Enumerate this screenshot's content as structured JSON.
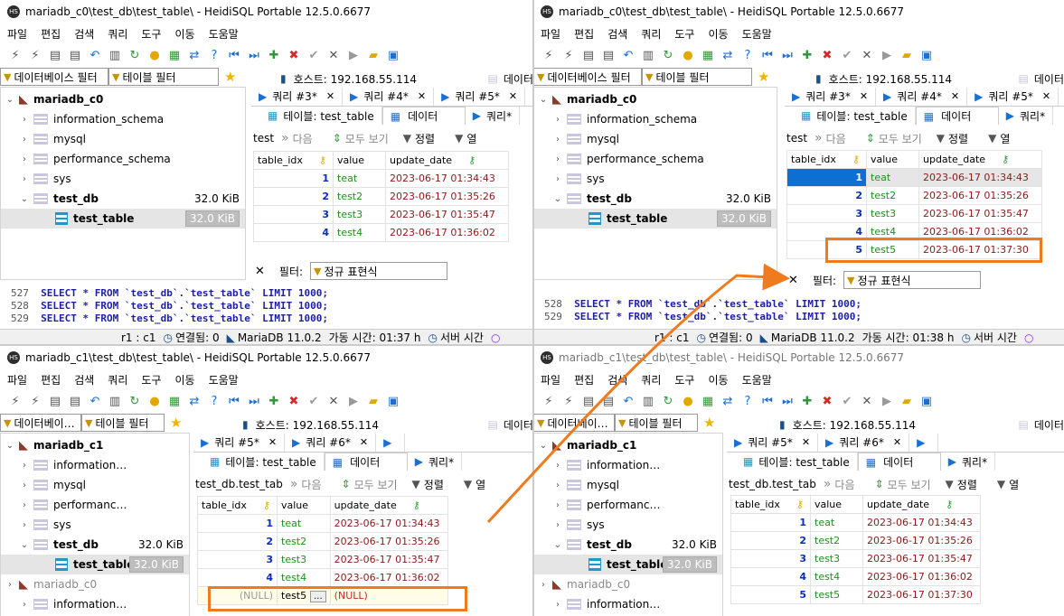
{
  "menu": [
    "파일",
    "편집",
    "검색",
    "쿼리",
    "도구",
    "이동",
    "도움말"
  ],
  "filters": {
    "db": "데이터베이스 필터",
    "db_short": "데이터베이…",
    "table": "테이블 필터"
  },
  "host_label": "호스트: 192.168.55.114",
  "data_tab_short": "데이터",
  "tabs": {
    "table": "테이블: test_table",
    "data": "데이터",
    "query": "쿼리*"
  },
  "nav": {
    "next": "다음",
    "show_all": "모두 보기",
    "sort": "정렬",
    "col": "열"
  },
  "columns": [
    "table_idx",
    "value",
    "update_date"
  ],
  "filter": {
    "label": "필터:",
    "regex": "정규 표현식"
  },
  "colors": {
    "highlight": "#f07b1e",
    "selected": "#0c6fd1"
  },
  "panels": {
    "tl": {
      "title": "mariadb_c0\\test_db\\test_table\\ - HeidiSQL Portable 12.5.0.6677",
      "tree": [
        {
          "label": "mariadb_c0",
          "kind": "server"
        },
        {
          "label": "information_schema",
          "kind": "db"
        },
        {
          "label": "mysql",
          "kind": "db"
        },
        {
          "label": "performance_schema",
          "kind": "db"
        },
        {
          "label": "sys",
          "kind": "db"
        },
        {
          "label": "test_db",
          "kind": "db",
          "size": "32.0 KiB"
        },
        {
          "label": "test_table",
          "kind": "table",
          "size": "32.0 KiB"
        }
      ],
      "query_tabs": [
        "쿼리 #3*",
        "쿼리 #4*",
        "쿼리 #5*"
      ],
      "nav_prefix": "test",
      "rows": [
        [
          "1",
          "teat",
          "2023-06-17 01:34:43"
        ],
        [
          "2",
          "test2",
          "2023-06-17 01:35:26"
        ],
        [
          "3",
          "test3",
          "2023-06-17 01:35:47"
        ],
        [
          "4",
          "test4",
          "2023-06-17 01:36:02"
        ]
      ],
      "sql": [
        {
          "ln": "527",
          "code": "SELECT * FROM `test_db`.`test_table` LIMIT 1000;"
        },
        {
          "ln": "528",
          "code": "SELECT * FROM `test_db`.`test_table` LIMIT 1000;"
        },
        {
          "ln": "529",
          "code": "SELECT * FROM `test_db`.`test_table` LIMIT 1000;"
        }
      ],
      "status": [
        "r1 : c1",
        "연결됨: 0",
        "MariaDB 11.0.2",
        "가동 시간: 01:37 h",
        "서버 시간"
      ]
    },
    "tr": {
      "title": "mariadb_c0\\test_db\\test_table\\ - HeidiSQL Portable 12.5.0.6677",
      "tree": [
        {
          "label": "mariadb_c0",
          "kind": "server"
        },
        {
          "label": "information_schema",
          "kind": "db"
        },
        {
          "label": "mysql",
          "kind": "db"
        },
        {
          "label": "performance_schema",
          "kind": "db"
        },
        {
          "label": "sys",
          "kind": "db"
        },
        {
          "label": "test_db",
          "kind": "db",
          "size": "32.0 KiB"
        },
        {
          "label": "test_table",
          "kind": "table",
          "size": "32.0 KiB"
        }
      ],
      "query_tabs": [
        "쿼리 #3*",
        "쿼리 #4*",
        "쿼리 #5*"
      ],
      "nav_prefix": "test",
      "rows": [
        [
          "1",
          "teat",
          "2023-06-17 01:34:43"
        ],
        [
          "2",
          "test2",
          "2023-06-17 01:35:26"
        ],
        [
          "3",
          "test3",
          "2023-06-17 01:35:47"
        ],
        [
          "4",
          "test4",
          "2023-06-17 01:36:02"
        ],
        [
          "5",
          "test5",
          "2023-06-17 01:37:30"
        ]
      ],
      "sql": [
        {
          "ln": "528",
          "code": "SELECT * FROM `test_db`.`test_table` LIMIT 1000;"
        },
        {
          "ln": "529",
          "code": "SELECT * FROM `test_db`.`test_table` LIMIT 1000;"
        }
      ],
      "status": [
        "r1 : c1",
        "연결됨: 0",
        "MariaDB 11.0.2",
        "가동 시간: 01:38 h",
        "서버 시간"
      ]
    },
    "bl": {
      "title": "mariadb_c1\\test_db\\test_table\\ - HeidiSQL Portable 12.5.0.6677",
      "tree": [
        {
          "label": "mariadb_c1",
          "kind": "server"
        },
        {
          "label": "information…",
          "kind": "db"
        },
        {
          "label": "mysql",
          "kind": "db"
        },
        {
          "label": "performanc…",
          "kind": "db"
        },
        {
          "label": "sys",
          "kind": "db"
        },
        {
          "label": "test_db",
          "kind": "db",
          "size": "32.0 KiB"
        },
        {
          "label": "test_table",
          "kind": "table",
          "size": "32.0 KiB"
        },
        {
          "label": "mariadb_c0",
          "kind": "server2"
        },
        {
          "label": "information…",
          "kind": "db"
        }
      ],
      "query_tabs": [
        "쿼리 #5*",
        "쿼리 #6*"
      ],
      "nav_prefix": "test_db.test_tab",
      "rows": [
        [
          "1",
          "teat",
          "2023-06-17 01:34:43"
        ],
        [
          "2",
          "test2",
          "2023-06-17 01:35:26"
        ],
        [
          "3",
          "test3",
          "2023-06-17 01:35:47"
        ],
        [
          "4",
          "test4",
          "2023-06-17 01:36:02"
        ]
      ],
      "new_row": {
        "idx": "(NULL)",
        "value": "test5",
        "date": "(NULL)",
        "btn": "..."
      }
    },
    "br": {
      "title": "mariadb_c1\\test_db\\test_table\\ - HeidiSQL Portable 12.5.0.6677",
      "tree": [
        {
          "label": "mariadb_c1",
          "kind": "server"
        },
        {
          "label": "information…",
          "kind": "db"
        },
        {
          "label": "mysql",
          "kind": "db"
        },
        {
          "label": "performanc…",
          "kind": "db"
        },
        {
          "label": "sys",
          "kind": "db"
        },
        {
          "label": "test_db",
          "kind": "db",
          "size": "32.0 KiB"
        },
        {
          "label": "test_table",
          "kind": "table",
          "size": "32.0 KiB"
        },
        {
          "label": "mariadb_c0",
          "kind": "server2"
        },
        {
          "label": "information…",
          "kind": "db"
        }
      ],
      "query_tabs": [
        "쿼리 #5*",
        "쿼리 #6*"
      ],
      "nav_prefix": "test_db.test_tab",
      "rows": [
        [
          "1",
          "teat",
          "2023-06-17 01:34:43"
        ],
        [
          "2",
          "test2",
          "2023-06-17 01:35:26"
        ],
        [
          "3",
          "test3",
          "2023-06-17 01:35:47"
        ],
        [
          "4",
          "test4",
          "2023-06-17 01:36:02"
        ],
        [
          "5",
          "test5",
          "2023-06-17 01:37:30"
        ]
      ]
    }
  }
}
